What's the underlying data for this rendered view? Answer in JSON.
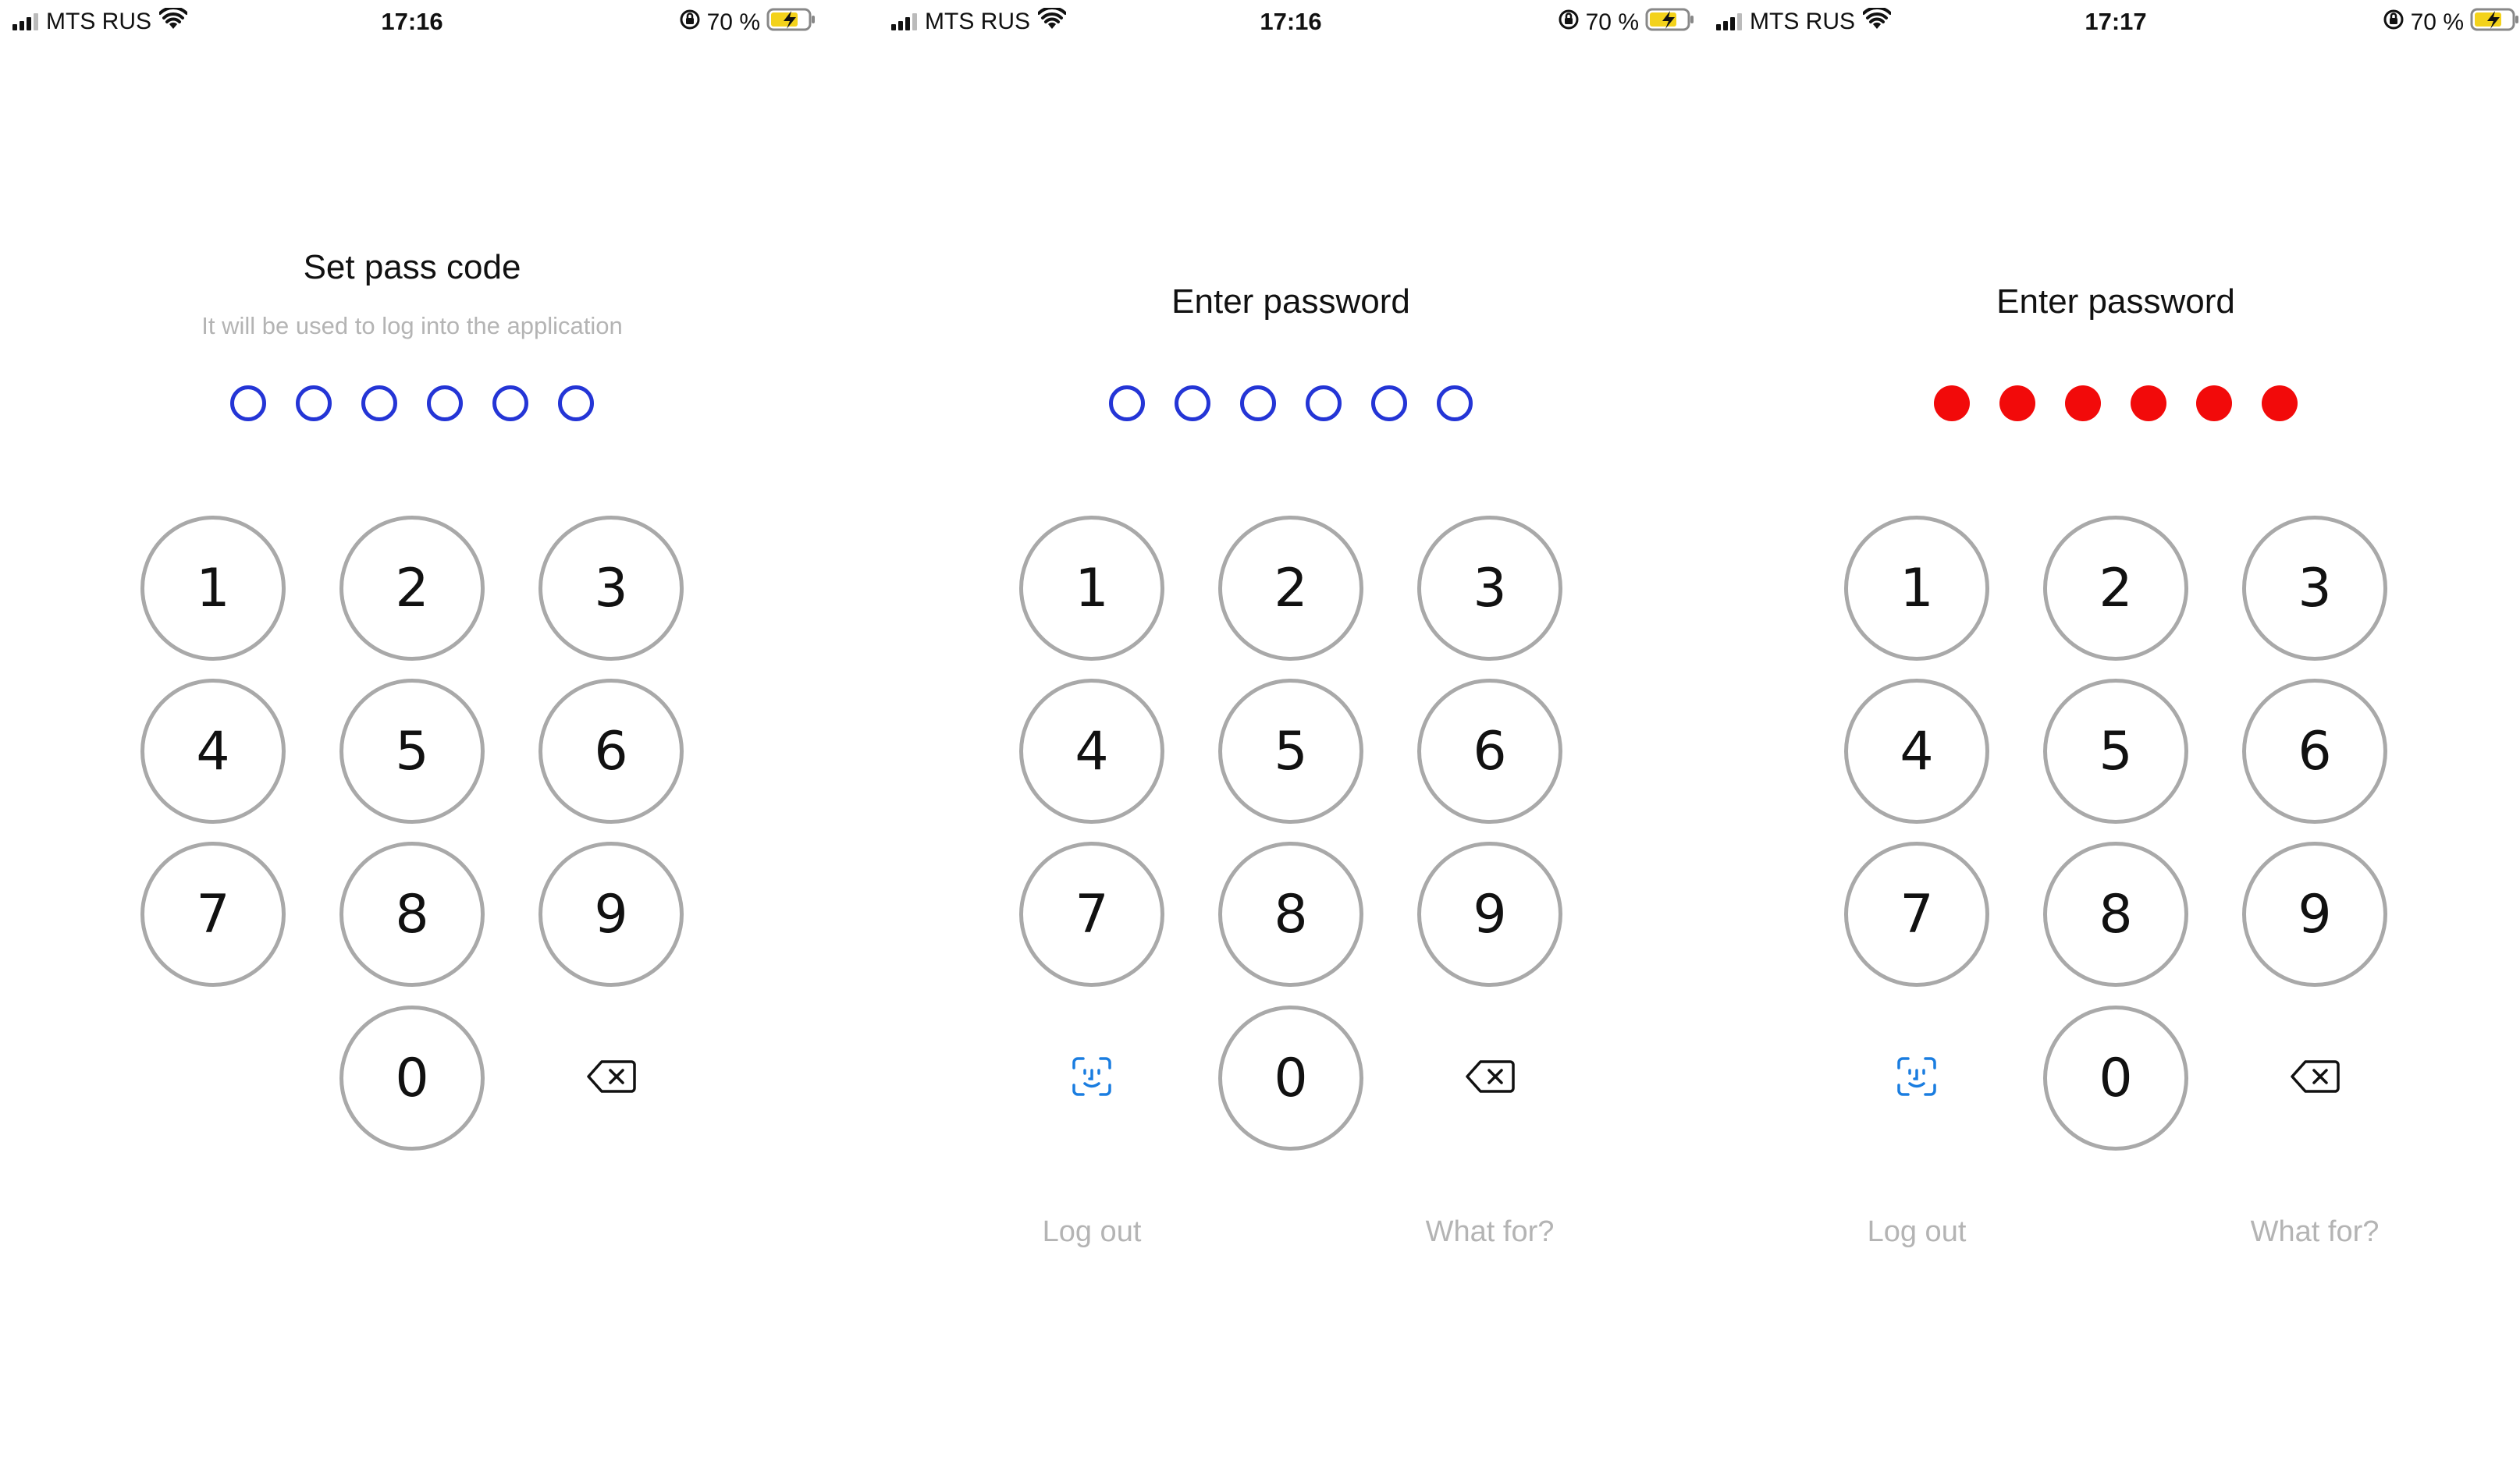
{
  "screens": [
    {
      "status": {
        "carrier": "MTS RUS",
        "time": "17:16",
        "battery": "70 %"
      },
      "title": "Set pass code",
      "subtitle": "It will be used to log into the application",
      "dots_state": "empty",
      "keys": [
        "1",
        "2",
        "3",
        "4",
        "5",
        "6",
        "7",
        "8",
        "9",
        "0"
      ],
      "left_action": null,
      "links": null
    },
    {
      "status": {
        "carrier": "MTS RUS",
        "time": "17:16",
        "battery": "70 %"
      },
      "title": "Enter password",
      "subtitle": null,
      "dots_state": "empty",
      "keys": [
        "1",
        "2",
        "3",
        "4",
        "5",
        "6",
        "7",
        "8",
        "9",
        "0"
      ],
      "left_action": "face-id-icon",
      "links": {
        "logout": "Log out",
        "whatfor": "What for?"
      }
    },
    {
      "status": {
        "carrier": "MTS RUS",
        "time": "17:17",
        "battery": "70 %"
      },
      "title": "Enter password",
      "subtitle": null,
      "dots_state": "error",
      "keys": [
        "1",
        "2",
        "3",
        "4",
        "5",
        "6",
        "7",
        "8",
        "9",
        "0"
      ],
      "left_action": "face-id-icon",
      "links": {
        "logout": "Log out",
        "whatfor": "What for?"
      }
    }
  ],
  "colors": {
    "dot_outline": "#2435d6",
    "dot_error": "#f20a0a",
    "key_border": "#a9a9a9",
    "muted_text": "#b4b4b4",
    "face_id": "#1a7de0",
    "battery_fill": "#f3d21b"
  },
  "icons": {
    "delete": "backspace-icon",
    "face_id": "face-id-icon",
    "wifi": "wifi-icon",
    "signal": "signal-icon",
    "battery": "battery-icon",
    "orientation_lock": "orientation-lock-icon"
  }
}
